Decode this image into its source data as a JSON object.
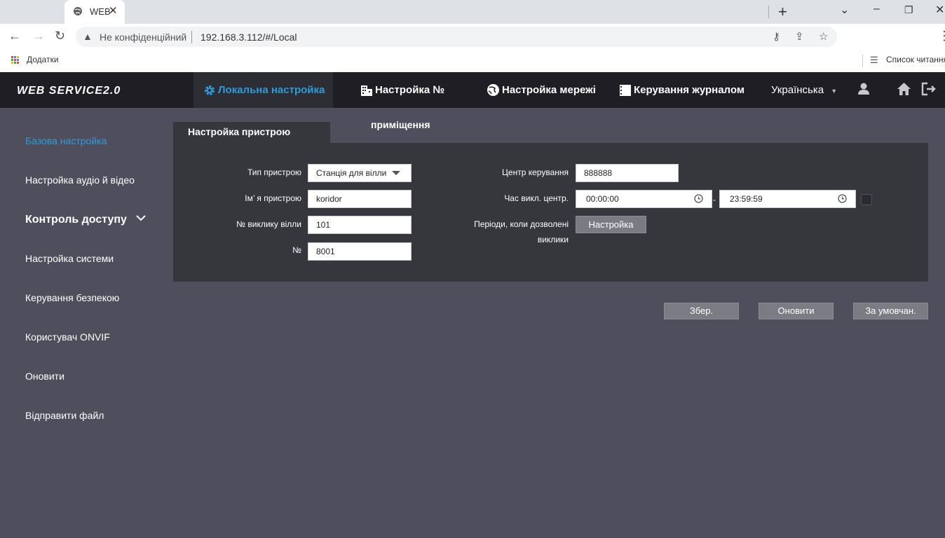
{
  "browser": {
    "tab_title": "WEB",
    "omnibox": {
      "security_label": "Не конфіденційний",
      "url": "192.168.3.112/#/Local"
    },
    "bookmarks": {
      "apps_label": "Додатки",
      "reading_list_label": "Список читання"
    }
  },
  "app": {
    "logo": "WEB SERVICE2.0",
    "nav": [
      {
        "label": "Локальна настройка"
      },
      {
        "label": "Настройка №"
      },
      {
        "label": "Настройка мережі"
      },
      {
        "label": "Керування журналом"
      }
    ],
    "language": "Українська",
    "accent_color": "#2d9cdb"
  },
  "sidebar": {
    "items": [
      {
        "label": "Базова настройка"
      },
      {
        "label": "Настройка аудіо й відео"
      },
      {
        "label": "Контроль доступу"
      },
      {
        "label": "Настройка системи"
      },
      {
        "label": "Керування безпекою"
      },
      {
        "label": "Користувач ONVIF"
      },
      {
        "label": "Оновити"
      },
      {
        "label": "Відправити файл"
      }
    ]
  },
  "tabs": {
    "device": "Настройка пристрою",
    "room": "приміщення"
  },
  "form": {
    "device_type": {
      "label": "Тип пристрою",
      "value": "Станція для вілли"
    },
    "device_name": {
      "label": "Ім’ я пристрою",
      "value": "koridor"
    },
    "villa_call_no": {
      "label": "№ виклику вілли",
      "value": "101"
    },
    "number": {
      "label": "№",
      "value": "8001"
    },
    "control_center": {
      "label": "Центр керування",
      "value": "888888"
    },
    "call_center_time": {
      "label": "Час викл. центр.",
      "start": "00:00:00",
      "separator": "-",
      "end": "23:59:59"
    },
    "allowed_periods": {
      "label_line1": "Періоди, коли дозволені",
      "label_line2": "виклики",
      "button": "Настройка"
    }
  },
  "actions": {
    "save": "Збер.",
    "refresh": "Оновити",
    "default": "За умовчан."
  }
}
